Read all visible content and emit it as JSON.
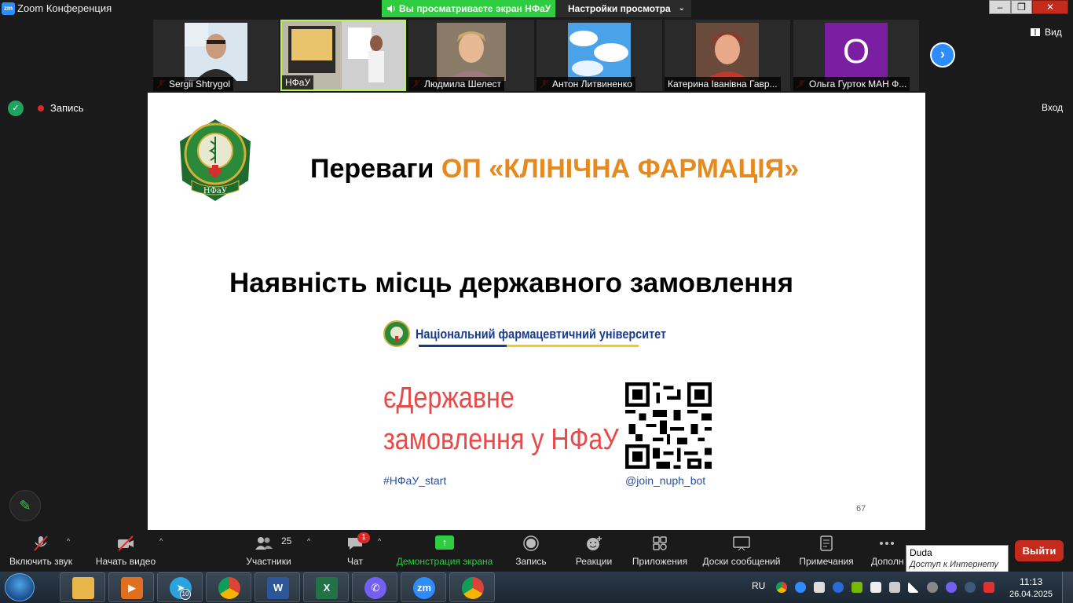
{
  "window": {
    "app_icon": "zm",
    "title": "Zoom Конференция",
    "sharing_banner": "Вы просматриваете экран НФаУ",
    "view_settings": "Настройки просмотра"
  },
  "participants_strip": [
    {
      "name": "Sergii Shtrygol",
      "muted": true
    },
    {
      "name": "НФаУ",
      "muted": false
    },
    {
      "name": "Людмила Шелест",
      "muted": true
    },
    {
      "name": "Антон Литвиненко",
      "muted": true
    },
    {
      "name": "Катерина Іванівна Гавр...",
      "muted": false
    },
    {
      "name": "Ольга Гурток МАН Ф...",
      "muted": true,
      "avatar_letter": "O"
    }
  ],
  "top_controls": {
    "view_label": "Вид",
    "recording_label": "Запись",
    "exit_label": "Вход"
  },
  "slide": {
    "heading_prefix": "Переваги ",
    "heading_highlight": "ОП «КЛІНІЧНА ФАРМАЦІЯ»",
    "subheading": "Наявність місць державного замовлення",
    "seal_text": "НФаУ",
    "university_name": "Національний фармацевтичний університет",
    "promo_line1": "єДержавне",
    "promo_line2": "замовлення у НФаУ",
    "hashtag": "#НФаУ_start",
    "bot_handle": "@join_nuph_bot",
    "page_number": "67",
    "colors": {
      "accent": "#e68a1f",
      "promo": "#e84a4a",
      "link": "#2a4ea0"
    }
  },
  "toolbar": {
    "mute": "Включить звук",
    "video": "Начать видео",
    "participants": "Участники",
    "participants_count": "25",
    "chat": "Чат",
    "chat_badge": "1",
    "share": "Демонстрация экрана",
    "record": "Запись",
    "reactions": "Реакции",
    "apps": "Приложения",
    "whiteboards": "Доски сообщений",
    "notes": "Примечания",
    "more": "Дополн",
    "leave": "Выйти"
  },
  "tooltip": {
    "title": "Duda",
    "subtitle": "Доступ к Интернету"
  },
  "taskbar": {
    "apps": [
      "file-explorer",
      "media-player",
      "telegram",
      "chrome",
      "word",
      "excel",
      "viber",
      "zoom",
      "chrome-profile"
    ],
    "telegram_badge": "10",
    "zoom_label": "zm",
    "word_label": "W",
    "excel_label": "X",
    "language": "RU",
    "time": "11:13",
    "date": "26.04.2025"
  }
}
